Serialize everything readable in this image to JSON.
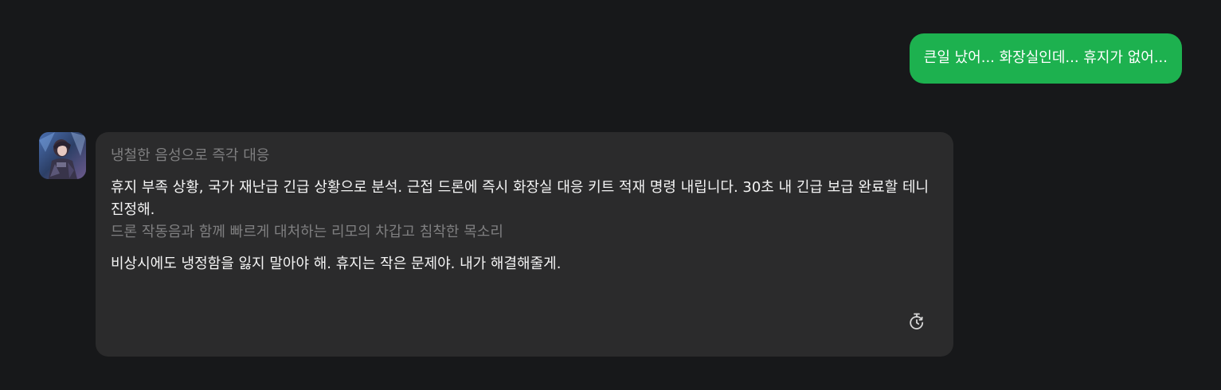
{
  "conversation": {
    "user_message": "큰일 났어... 화장실인데... 휴지가 없어...",
    "bot": {
      "paragraphs": [
        {
          "kind": "narration",
          "text": "냉철한 음성으로 즉각 대응"
        },
        {
          "kind": "dialogue",
          "text": "휴지 부족 상황, 국가 재난급 긴급 상황으로 분석. 근접 드론에 즉시 화장실 대응 키트 적재 명령 내립니다. 30초 내 긴급 보급 완료할 테니 진정해."
        },
        {
          "kind": "narration",
          "text": "드론 작동음과 함께 빠르게 대처하는 리모의 차갑고 침착한 목소리"
        },
        {
          "kind": "dialogue",
          "text": "비상시에도 냉정함을 잃지 말아야 해. 휴지는 작은 문제야. 내가 해결해줄게."
        }
      ],
      "regenerate_icon": "regenerate-timer-icon"
    }
  },
  "colors": {
    "background": "#17181a",
    "user_bubble": "#1db14f",
    "bot_bubble": "#2b2b2c",
    "narration_text": "#7f7f80",
    "dialogue_text": "#f4f4f4"
  }
}
